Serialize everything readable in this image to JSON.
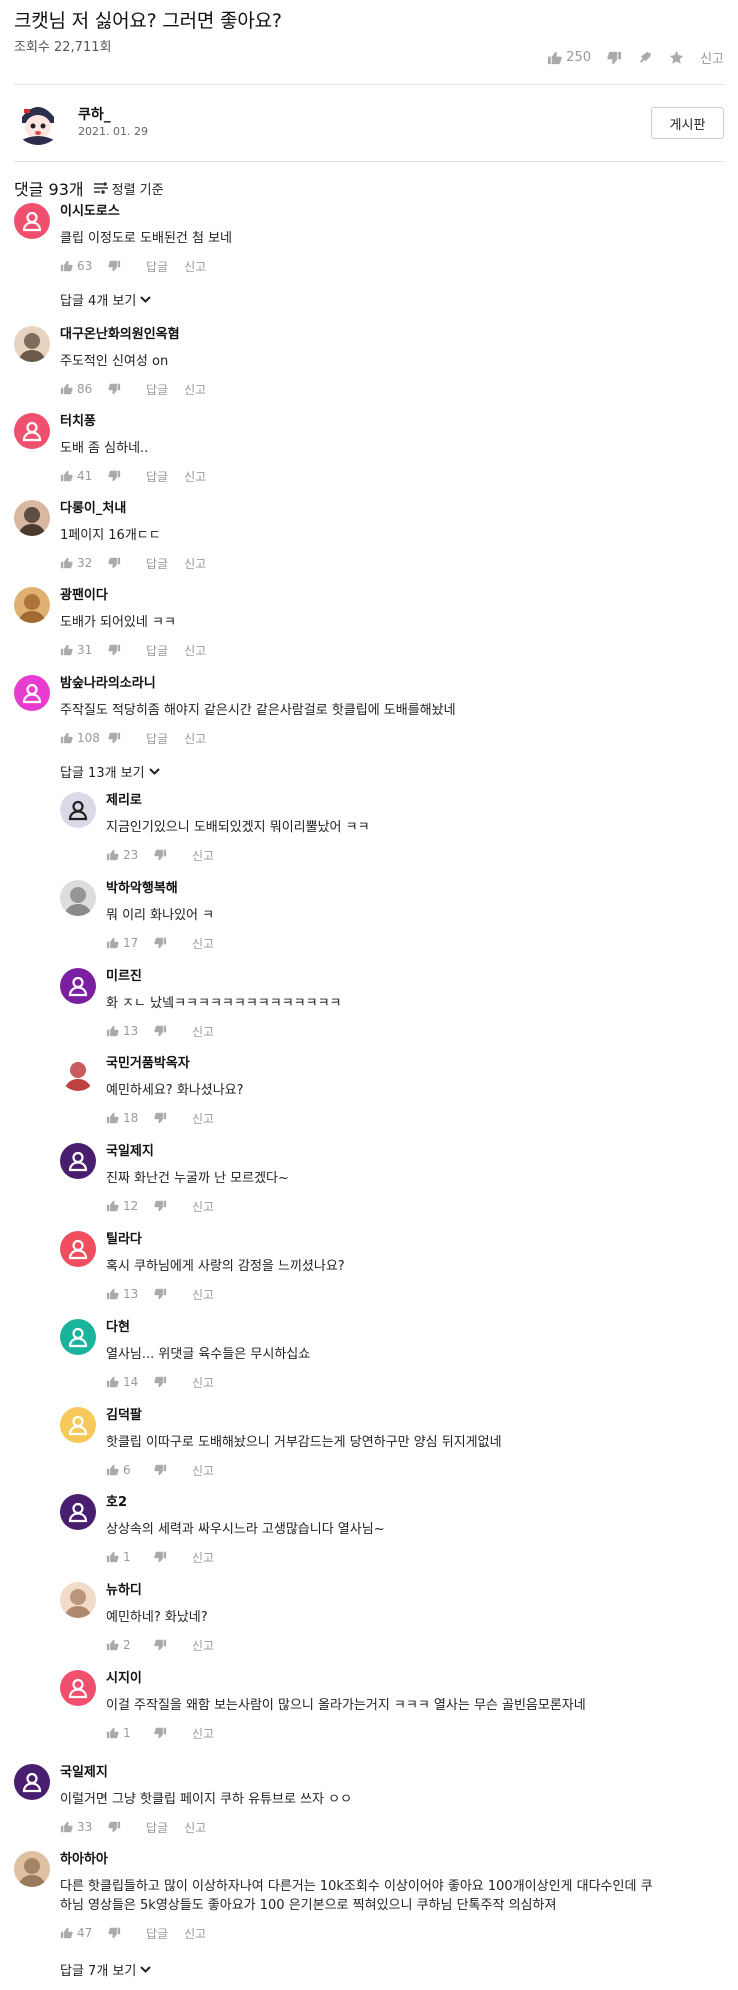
{
  "post": {
    "title": "크캣님 저 싫어요? 그러면 좋아요?",
    "views": "조회수 22,711회",
    "likes": "250",
    "report_label": "신고"
  },
  "author": {
    "name": "쿠하_",
    "date": "2021. 01. 29",
    "board_button": "게시판"
  },
  "comments_header": {
    "count": "댓글 93개",
    "sort_label": "정렬 기준"
  },
  "labels": {
    "reply": "답글",
    "report": "신고"
  },
  "comments": [
    {
      "name": "이시도로스",
      "text": "클립 이정도로 도배된건 첨 보네",
      "likes": "63",
      "avatar": "default-pink"
    },
    {
      "name": "대구온난화의원인옥혐",
      "text": "주도적인 신여성 on",
      "likes": "86",
      "avatar": "photo"
    },
    {
      "name": "터치퐁",
      "text": "도배 좀 심하네..",
      "likes": "41",
      "avatar": "default-pink"
    },
    {
      "name": "다롱이_처내",
      "text": "1페이지 16개ㄷㄷ",
      "likes": "32",
      "avatar": "photo"
    },
    {
      "name": "광팬이다",
      "text": "도배가 되어있네 ㅋㅋ",
      "likes": "31",
      "avatar": "photo"
    },
    {
      "name": "밤숲나라의소라니",
      "text": "주작질도 적당히좀 해야지 같은시간 같은사람걸로 핫클립에 도배를해놨네",
      "likes": "108",
      "avatar": "default-magenta"
    }
  ],
  "more_replies": [
    "답글 4개 보기",
    "답글 13개 보기",
    "답글 7개 보기"
  ],
  "replies": [
    {
      "name": "제리로",
      "text": "지금인기있으니 도배되있겠지 뭐이리뿔났어 ㅋㅋ",
      "likes": "23",
      "avatar": "default-gray"
    },
    {
      "name": "박하악행복해",
      "text": "뭐 이리 화나있어 ㅋ",
      "likes": "17",
      "avatar": "photo"
    },
    {
      "name": "미르진",
      "text": "화 ㅈㄴ 났넼ㅋㅋㅋㅋㅋㅋㅋㅋㅋㅋㅋㅋㅋㅋ",
      "likes": "13",
      "avatar": "default-purple"
    },
    {
      "name": "국민거품박옥자",
      "text": "예민하세요? 화나셨나요?",
      "likes": "18",
      "avatar": "photo"
    },
    {
      "name": "국일제지",
      "text": "진짜 화난건 누굴까 난 모르겠다~",
      "likes": "12",
      "avatar": "default-darkpurple"
    },
    {
      "name": "틸라다",
      "text": "혹시 쿠하님에게 사랑의 감정을 느끼셨나요?",
      "likes": "13",
      "avatar": "default-red"
    },
    {
      "name": "다현",
      "text": "열사님... 위댓글 육수들은 무시하십쇼",
      "likes": "14",
      "avatar": "default-teal"
    },
    {
      "name": "김덕팔",
      "text": "핫클립 이따구로 도배해놨으니 거부감드는게 당연하구만 양심 뒤지게없네",
      "likes": "6",
      "avatar": "default-yellow"
    },
    {
      "name": "호2",
      "text": "상상속의 세력과 싸우시느라 고생많습니다 열사님~",
      "likes": "1",
      "avatar": "default-darkpurple"
    },
    {
      "name": "뉴하디",
      "text": "예민하네? 화났네?",
      "likes": "2",
      "avatar": "photo"
    },
    {
      "name": "시지이",
      "text": "이걸 주작질을 왜함 보는사람이 많으니 올라가는거지 ㅋㅋㅋ 열사는 무슨 골빈음모론자네",
      "likes": "1",
      "avatar": "default-pink"
    }
  ],
  "bottom_comments": [
    {
      "name": "국일제지",
      "text": "이럴거면 그냥 핫클립 페이지 쿠하 유튜브로 쓰자 ㅇㅇ",
      "likes": "33",
      "avatar": "default-darkpurple"
    },
    {
      "name": "하아하아",
      "text_lines": [
        "다른 핫클립들하고 많이 이상하자나여 다른거는 10k조회수 이상이어야 좋아요 100개이상인게 대다수인데 쿠",
        "하님 영상들은 5k영상들도 좋아요가 100 은기본으로 찍혀있으니 쿠하님 단톡주작 의심하져"
      ],
      "likes": "47",
      "avatar": "photo"
    }
  ],
  "colors": {
    "pink": "#f0506e",
    "magenta": "#e83bcf",
    "gray_avatar": "#d9d9e8",
    "purple": "#7b1fa2",
    "darkpurple": "#4a1e6e",
    "red": "#f04d5f",
    "teal": "#1ab39b",
    "yellow": "#f7c85a"
  }
}
